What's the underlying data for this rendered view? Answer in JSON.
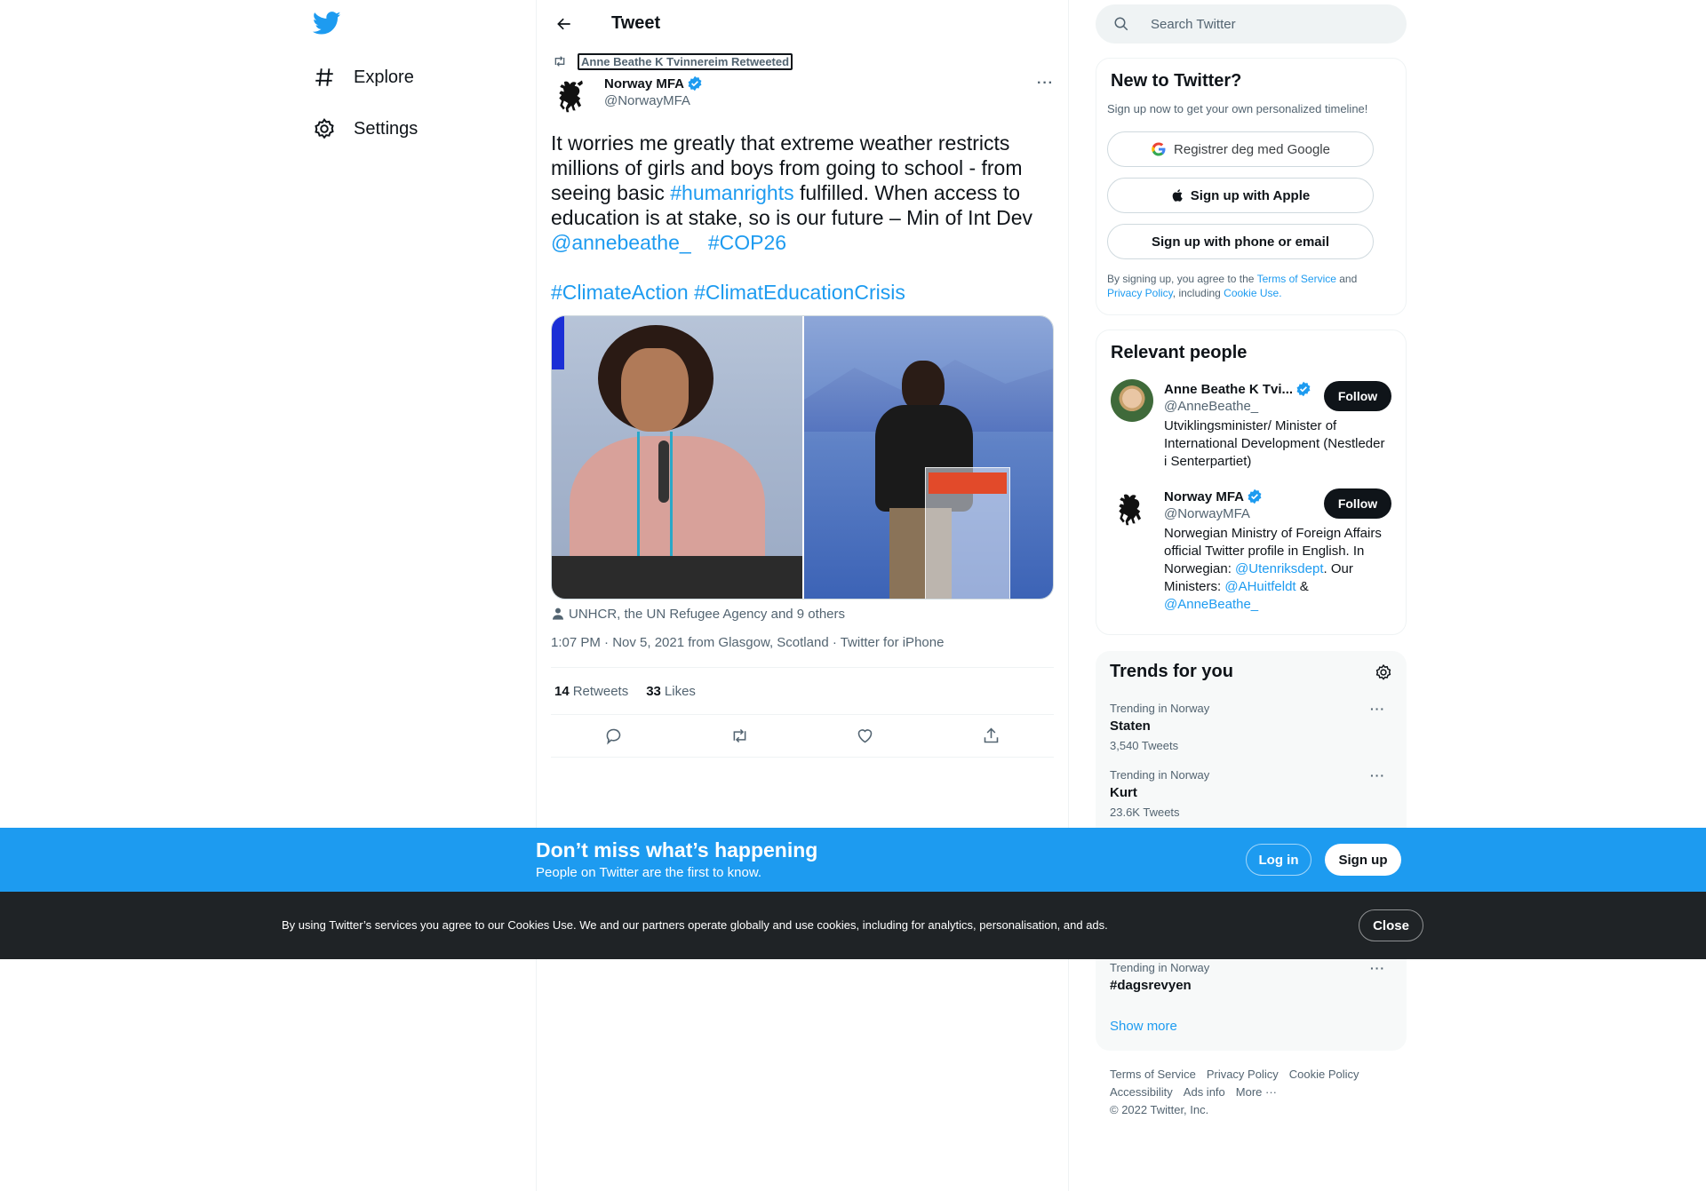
{
  "nav": {
    "items": [
      {
        "label": "Explore",
        "icon": "hashtag-icon"
      },
      {
        "label": "Settings",
        "icon": "gear-icon"
      }
    ]
  },
  "header": {
    "title": "Tweet"
  },
  "tweet": {
    "retweeted_by": "Anne Beathe K Tvinnereim Retweeted",
    "author_name": "Norway MFA",
    "author_handle": "@NorwayMFA",
    "text_part1": "It worries me greatly that extreme weather restricts millions of girls and boys from going to school - from seeing basic ",
    "hashtag_humanrights": "#humanrights",
    "text_part2": " fulfilled. When access to education is at stake, so is our future – Min of Int Dev ",
    "mention_annebeathe": "@annebeathe_",
    "hashtag_cop26": "#COP26",
    "hashtag_climateaction": "#ClimateAction",
    "hashtag_climateducation": "#ClimatEducationCrisis",
    "tagged": "UNHCR, the UN Refugee Agency and 9 others",
    "meta": "1:07 PM · Nov 5, 2021 from Glasgow, Scotland · Twitter for iPhone",
    "retweets_count": "14",
    "retweets_label": "Retweets",
    "likes_count": "33",
    "likes_label": "Likes"
  },
  "search": {
    "placeholder": "Search Twitter"
  },
  "new_to_twitter": {
    "title": "New to Twitter?",
    "subtitle": "Sign up now to get your own personalized timeline!",
    "google_btn": "Registrer deg med Google",
    "apple_btn": "Sign up with Apple",
    "phone_btn": "Sign up with phone or email",
    "legal_prefix": "By signing up, you agree to the ",
    "terms": "Terms of Service",
    "and": " and",
    "privacy": "Privacy Policy",
    "including": ", including ",
    "cookie": "Cookie Use."
  },
  "relevant_people": {
    "title": "Relevant people",
    "people": [
      {
        "name": "Anne Beathe K Tvi...",
        "handle": "@AnneBeathe_",
        "bio": "Utviklingsminister/ Minister of International Development (Nestleder i Senterpartiet)",
        "follow": "Follow"
      },
      {
        "name": "Norway MFA",
        "handle": "@NorwayMFA",
        "bio_part1": "Norwegian Ministry of Foreign Affairs official Twitter profile in English. In Norwegian: ",
        "bio_link1": "@Utenriksdept",
        "bio_part2": ". Our Ministers: ",
        "bio_link2": "@AHuitfeldt",
        "bio_part3": " & ",
        "bio_link3": "@AnneBeathe_",
        "follow": "Follow"
      }
    ]
  },
  "trends": {
    "title": "Trends for you",
    "items": [
      {
        "context": "Trending in Norway",
        "name": "Staten",
        "count": "3,540 Tweets"
      },
      {
        "context": "Trending in Norway",
        "name": "Kurt",
        "count": "23.6K Tweets"
      },
      {
        "context": "Trending in Norway",
        "name": "#dagsrevyen",
        "count": ""
      }
    ],
    "show_more": "Show more"
  },
  "footer": {
    "terms": "Terms of Service",
    "privacy": "Privacy Policy",
    "cookie": "Cookie Policy",
    "accessibility": "Accessibility",
    "ads": "Ads info",
    "more": "More ···",
    "copyright": "© 2022 Twitter, Inc."
  },
  "banner": {
    "title": "Don’t miss what’s happening",
    "subtitle": "People on Twitter are the first to know.",
    "login": "Log in",
    "signup": "Sign up"
  },
  "cookie_bar": {
    "text": "By using Twitter’s services you agree to our Cookies Use. We and our partners operate globally and use cookies, including for analytics, personalisation, and ads.",
    "close": "Close"
  },
  "colors": {
    "brand": "#1d9bf0",
    "text": "#0f1419",
    "secondary": "#536471",
    "cookie_bg": "#1f2326"
  }
}
